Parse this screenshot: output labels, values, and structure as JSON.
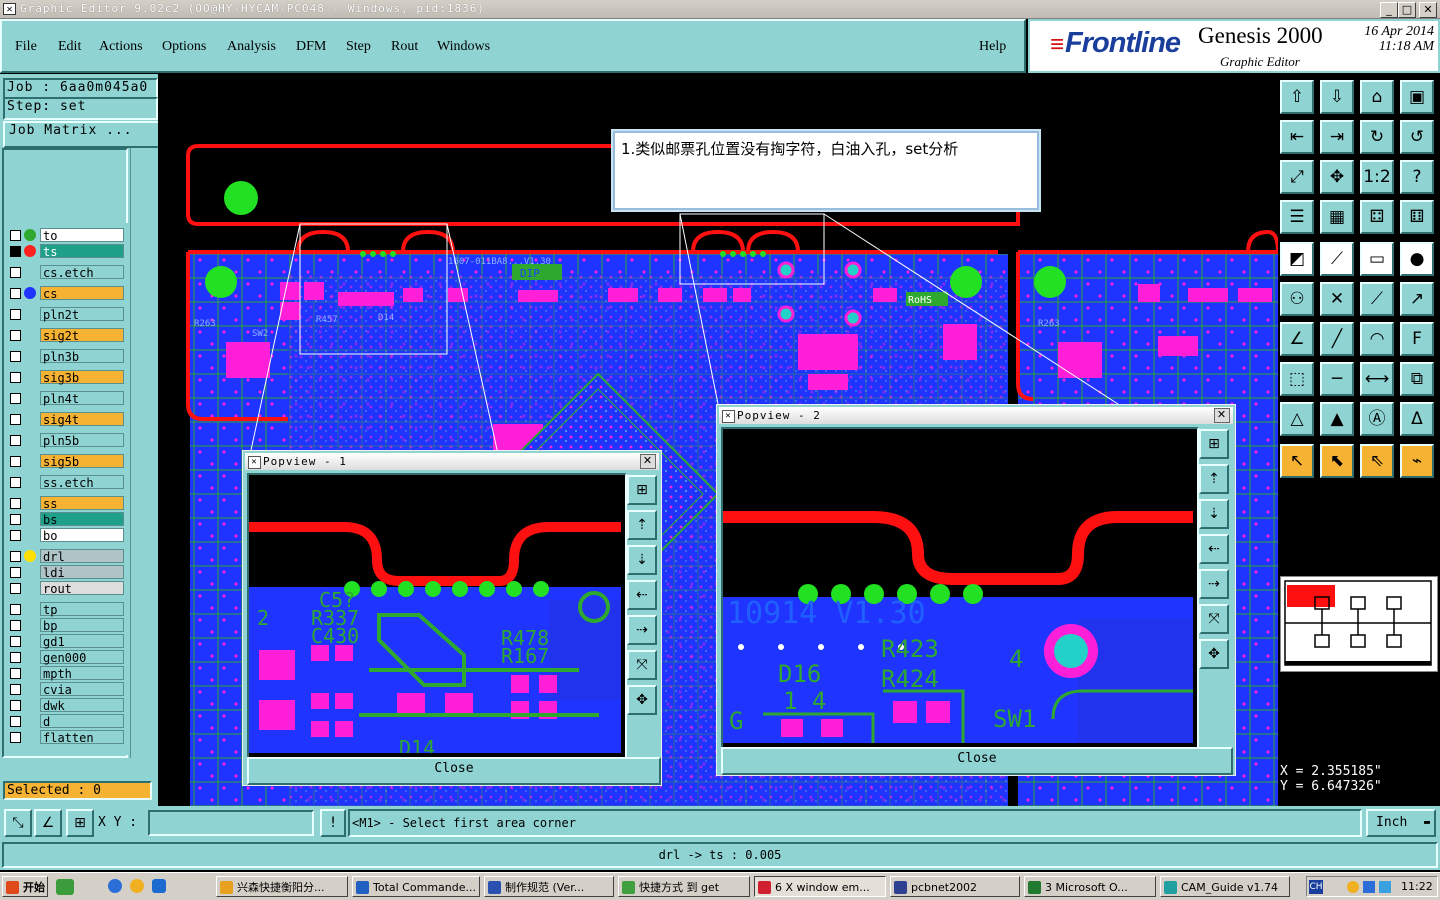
{
  "window": {
    "title": "Graphic Editor 9.02c2 (OO@HY-HYCAM-PC048 - Windows, pid:1836)",
    "minimize": "_",
    "maximize": "□",
    "close": "✕"
  },
  "menu": {
    "items": [
      "File",
      "Edit",
      "Actions",
      "Options",
      "Analysis",
      "DFM",
      "Step",
      "Rout",
      "Windows"
    ],
    "help": "Help"
  },
  "brand": {
    "logo": "Frontline",
    "product": "Genesis 2000",
    "subtitle": "Graphic Editor",
    "date": "16 Apr 2014",
    "time": "11:18 AM"
  },
  "job": {
    "job_label": "Job : 6aa0m045a0",
    "step_label": "Step: set",
    "matrix_button": "Job Matrix ..."
  },
  "layers": [
    {
      "name": "to",
      "color": "#ffffff",
      "dot": "#2fa82f"
    },
    {
      "name": "ts",
      "color": "#1fa08a",
      "dot": "#ff2020",
      "active": true
    },
    {
      "name": "cs.etch",
      "color": "#8fd3d3"
    },
    {
      "name": "cs",
      "color": "#f5b233",
      "dot": "#1f35ff"
    },
    {
      "name": "pln2t",
      "color": "#8fd3d3"
    },
    {
      "name": "sig2t",
      "color": "#f5b233"
    },
    {
      "name": "pln3b",
      "color": "#8fd3d3"
    },
    {
      "name": "sig3b",
      "color": "#f5b233"
    },
    {
      "name": "pln4t",
      "color": "#8fd3d3"
    },
    {
      "name": "sig4t",
      "color": "#f5b233"
    },
    {
      "name": "pln5b",
      "color": "#8fd3d3"
    },
    {
      "name": "sig5b",
      "color": "#f5b233"
    },
    {
      "name": "ss.etch",
      "color": "#8fd3d3"
    },
    {
      "name": "ss",
      "color": "#f5b233"
    },
    {
      "name": "bs",
      "color": "#1fa08a"
    },
    {
      "name": "bo",
      "color": "#ffffff"
    },
    {
      "name": "drl",
      "color": "#b0c4c8",
      "dot": "#ffe000"
    },
    {
      "name": "ldi",
      "color": "#b0c4c8"
    },
    {
      "name": "rout",
      "color": "#dddddd"
    },
    {
      "name": "tp",
      "color": "#8fd3d3"
    },
    {
      "name": "bp",
      "color": "#8fd3d3"
    },
    {
      "name": "gd1",
      "color": "#8fd3d3"
    },
    {
      "name": "gen000",
      "color": "#8fd3d3"
    },
    {
      "name": "mpth",
      "color": "#8fd3d3"
    },
    {
      "name": "cvia",
      "color": "#8fd3d3"
    },
    {
      "name": "dwk",
      "color": "#8fd3d3"
    },
    {
      "name": "d",
      "color": "#8fd3d3"
    },
    {
      "name": "flatten",
      "color": "#8fd3d3"
    }
  ],
  "selected": "Selected : 0",
  "annotation": "1.类似邮票孔位置没有掏字符，白油入孔，set分析",
  "board_labels": {
    "dip": "DIP",
    "rohs": "RoHS",
    "r263": "R263",
    "sw2": "SW2",
    "r457": "R457",
    "r458": "R458",
    "d14": "D14",
    "r415": "R415",
    "version": "1607-011BA8...V1.30"
  },
  "popview1": {
    "title": "Popview - 1",
    "close_button": "Close",
    "labels": [
      "C5?",
      "R337",
      "C430",
      "R478",
      "R167",
      "D14",
      "2"
    ]
  },
  "popview2": {
    "title": "Popview - 2",
    "close_button": "Close",
    "labels": [
      "10914  V1.30",
      "R423",
      "R424",
      "D16",
      "SW1",
      "4",
      "1 4",
      "G"
    ]
  },
  "coords": {
    "x": "X = 2.355185\"",
    "y": "Y = 6.647326\""
  },
  "command": {
    "xy_label": "X Y :",
    "xy_value": "",
    "prompt": "<M1> - Select first area corner",
    "units": "Inch"
  },
  "status": {
    "message": "drl -> ts : 0.005"
  },
  "taskbar": {
    "start": "开始",
    "tasks": [
      "兴森快捷衡阳分...",
      "Total Commande...",
      "制作规范 (Ver...",
      "快捷方式 到 get",
      "6 X window em...",
      "pcbnet2002",
      "3 Microsoft O...",
      "CAM_Guide v1.74"
    ],
    "clock": "11:22",
    "tray_lang": "CH"
  },
  "colors": {
    "panel": "#8fd3d3",
    "orange": "#f5b233",
    "pad_magenta": "#ff1fd8",
    "board_blue": "#1f35ff",
    "rout_red": "#ff1010",
    "drill_green": "#22e022",
    "trace_green": "#2fa82f"
  }
}
